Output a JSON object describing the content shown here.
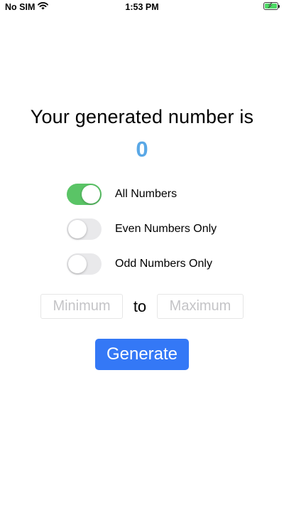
{
  "status_bar": {
    "carrier": "No SIM",
    "time": "1:53 PM",
    "icons": [
      "wifi-icon",
      "battery-charging-icon"
    ]
  },
  "main": {
    "title": "Your generated number is",
    "number": "0",
    "number_color": "#5aa8e6"
  },
  "toggles": [
    {
      "label": "All Numbers",
      "state": "on"
    },
    {
      "label": "Even Numbers Only",
      "state": "off"
    },
    {
      "label": "Odd Numbers Only",
      "state": "off"
    }
  ],
  "range": {
    "min_placeholder": "Minimum",
    "separator": "to",
    "max_placeholder": "Maximum"
  },
  "generate_button": {
    "label": "Generate",
    "color": "#3478f6"
  },
  "colors": {
    "toggle_on": "#5ac466",
    "toggle_off": "#e9e9eb"
  }
}
